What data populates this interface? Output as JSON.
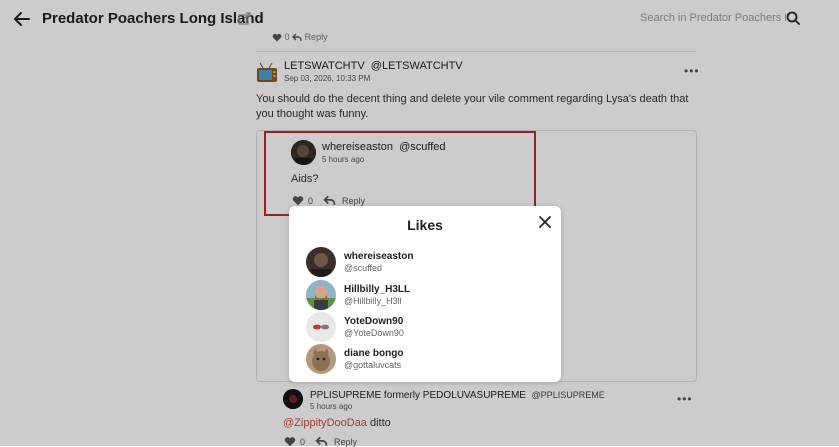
{
  "header": {
    "title": "Predator Poachers Long Island",
    "search_placeholder": "Search in Predator Poachers Lo..."
  },
  "fragment": {
    "count": "0",
    "reply": "Reply"
  },
  "post": {
    "name": "LETSWATCHTV",
    "handle": "@LETSWATCHTV",
    "date": "Sep 03, 2026, 10:33 PM",
    "body": "You should do the decent thing and delete your vile comment regarding Lysa's death that you thought was funny."
  },
  "quoted": {
    "name": "whereiseaston",
    "handle": "@scuffed",
    "time": "5 hours ago",
    "body": "Aids?",
    "likes": "0",
    "reply": "Reply"
  },
  "reply_comment": {
    "name": "PPLISUPREME formerly PEDOLUVASUPREME",
    "handle": "@PPLISUPREME",
    "time": "5 hours ago",
    "mention": "@ZippityDooDaa",
    "text": " ditto",
    "likes": "0",
    "reply": "Reply"
  },
  "likes_modal": {
    "title": "Likes",
    "users": [
      {
        "name": "whereiseaston",
        "handle": "@scuffed"
      },
      {
        "name": "Hillbilly_H3LL",
        "handle": "@Hillbilly_H3ll"
      },
      {
        "name": "YoteDown90",
        "handle": "@YoteDown90"
      },
      {
        "name": "diane bongo",
        "handle": "@gottaluvcats"
      }
    ]
  },
  "colors": {
    "highlight": "#c0282d",
    "mention": "#d14a45"
  }
}
